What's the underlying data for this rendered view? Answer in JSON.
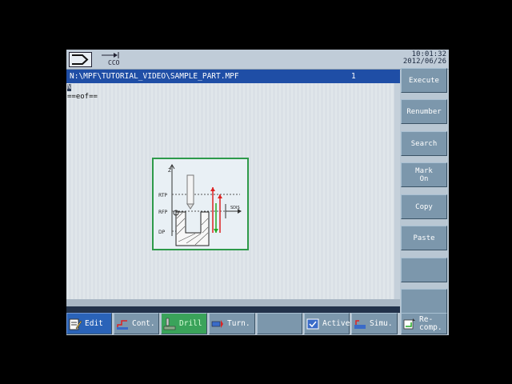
{
  "status": {
    "channel_label": "CCO",
    "time": "10:01:32",
    "date": "2012/06/26"
  },
  "header": {
    "path": "N:\\MPF\\TUTORIAL_VIDEO\\SAMPLE_PART.MPF",
    "line": "1"
  },
  "editor": {
    "cursor_char": "N",
    "eof_text": "==eof=="
  },
  "help_image": {
    "axis": "Z",
    "rtp": "RTP",
    "rfp": "RFP",
    "dp": "DP",
    "sdis": "SDIS"
  },
  "vertical_softkeys": [
    {
      "label": "Execute"
    },
    {
      "label": "Renumber"
    },
    {
      "label": "Search"
    },
    {
      "label": "Mark\nOn"
    },
    {
      "label": "Copy"
    },
    {
      "label": "Paste"
    },
    {
      "label": ""
    },
    {
      "label": ""
    }
  ],
  "horizontal_softkeys": [
    {
      "label": "Edit",
      "icon": "edit-icon"
    },
    {
      "label": "Cont.",
      "icon": "contour-icon"
    },
    {
      "label": "Drill",
      "icon": "drill-icon"
    },
    {
      "label": "Turn.",
      "icon": "turning-icon"
    },
    {
      "label": "",
      "icon": ""
    },
    {
      "label": "Active",
      "icon": "active-icon"
    },
    {
      "label": "Simu.",
      "icon": "simulation-icon"
    },
    {
      "label": "Re-\ncomp.",
      "icon": "recompile-icon"
    }
  ],
  "colors": {
    "header_blue": "#1f4ea6",
    "softkey": "#7c97ac",
    "edit_active": "#2a63b8",
    "drill_active": "#3aa35a",
    "help_border": "#2e9a4a"
  }
}
